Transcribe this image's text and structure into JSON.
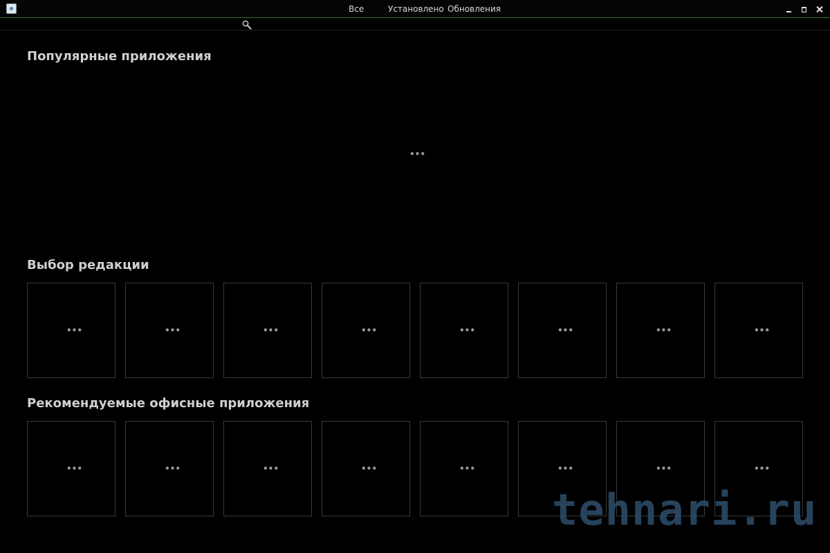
{
  "titlebar": {
    "tabs": [
      {
        "label": "Все"
      },
      {
        "label": "Установлено"
      },
      {
        "label": "Обновления"
      }
    ]
  },
  "search": {
    "value": "",
    "placeholder": ""
  },
  "sections": {
    "popular": {
      "title": "Популярные приложения",
      "loading": "•••"
    },
    "editors_choice": {
      "title": "Выбор редакции",
      "tiles": [
        "•••",
        "•••",
        "•••",
        "•••",
        "•••",
        "•••",
        "•••",
        "•••"
      ]
    },
    "office": {
      "title": "Рекомендуемые офисные приложения",
      "tiles": [
        "•••",
        "•••",
        "•••",
        "•••",
        "•••",
        "•••",
        "•••",
        "•••"
      ]
    }
  },
  "watermark": {
    "text": "tehnari.ru"
  },
  "colors": {
    "background": "#000000",
    "title_text": "#cfcfcf",
    "tile_border": "#3a3a3a",
    "titlebar_accent": "#3d6b3d",
    "watermark": "#2e4f6d"
  }
}
